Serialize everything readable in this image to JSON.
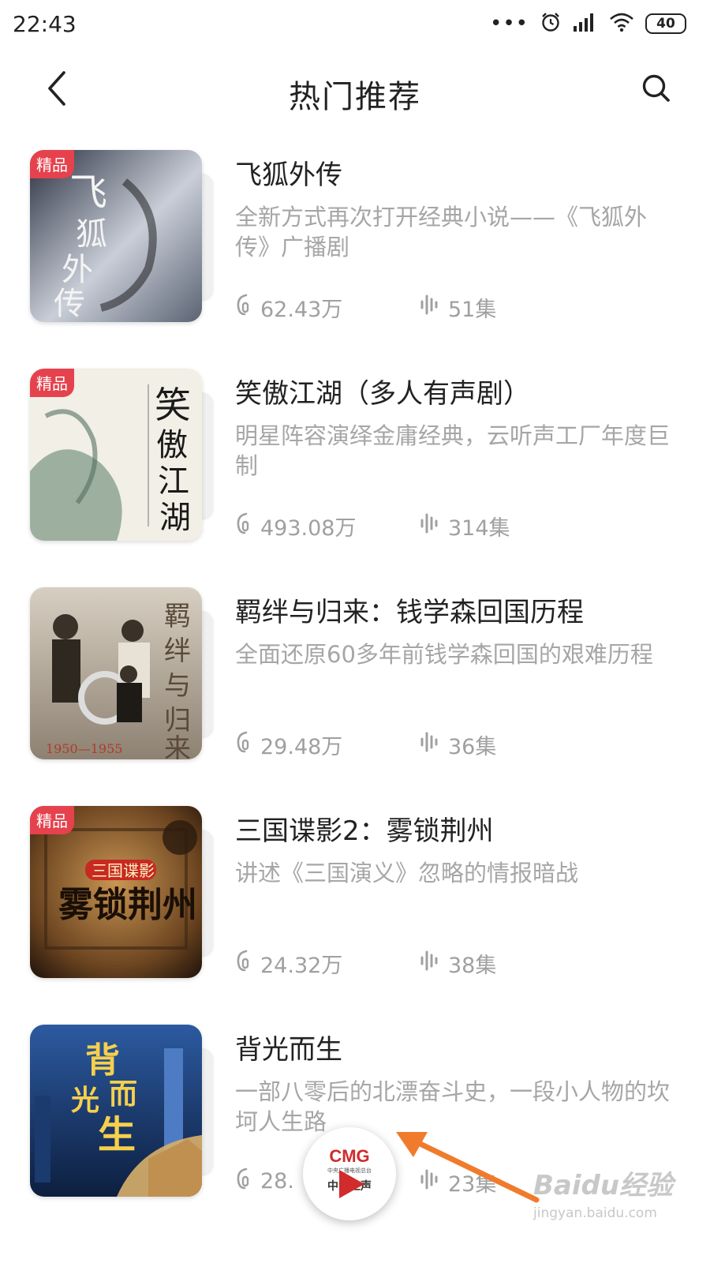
{
  "status_bar": {
    "time": "22:43",
    "dots": "•••",
    "battery": "40",
    "icons": [
      "alarm-icon",
      "signal-icon",
      "wifi-icon",
      "battery-icon"
    ]
  },
  "header": {
    "title": "热门推荐",
    "back_icon": "back-arrow-icon",
    "search_icon": "search-icon"
  },
  "items": [
    {
      "title": "飞狐外传",
      "description": "全新方式再次打开经典小说——《飞狐外传》广播剧",
      "plays": "62.43万",
      "episodes": "51集",
      "badge": "精品",
      "cover_text": "飞狐外传",
      "cover_colors": [
        "#c9ced8",
        "#2a3140"
      ]
    },
    {
      "title": "笑傲江湖（多人有声剧）",
      "description": "明星阵容演绎金庸经典，云听声工厂年度巨制",
      "plays": "493.08万",
      "episodes": "314集",
      "badge": "精品",
      "cover_text": "笑傲江湖",
      "cover_colors": [
        "#f1efe6",
        "#8ea593"
      ]
    },
    {
      "title": "羁绊与归来：钱学森回国历程",
      "description": "全面还原60多年前钱学森回国的艰难历程",
      "plays": "29.48万",
      "episodes": "36集",
      "badge": "",
      "cover_text": "羁绊与归来",
      "cover_years": "1950—1955",
      "cover_colors": [
        "#d7cfc2",
        "#5a4a3a"
      ]
    },
    {
      "title": "三国谍影2：雾锁荆州",
      "description": "讲述《三国演义》忽略的情报暗战",
      "plays": "24.32万",
      "episodes": "38集",
      "badge": "精品",
      "cover_text": "雾锁荆州",
      "cover_sub": "三国谍影",
      "cover_colors": [
        "#a8773b",
        "#2b1a0e"
      ]
    },
    {
      "title": "背光而生",
      "description": "一部八零后的北漂奋斗史，一段小人物的坎坷人生路",
      "plays": "28.",
      "episodes": "23集",
      "badge": "",
      "cover_text": "背光而生",
      "cover_colors": [
        "#2c5aa0",
        "#0d1f3f"
      ]
    }
  ],
  "float_player": {
    "logo": "CMG",
    "sub": "中央广播电视总台",
    "name": "中国之声",
    "icon": "play-icon"
  },
  "watermark": {
    "main": "Baidu经验",
    "url": "jingyan.baidu.com"
  },
  "colors": {
    "badge": "#e5424d",
    "muted_text": "#a6a6a6",
    "arrow": "#f07b2c"
  }
}
